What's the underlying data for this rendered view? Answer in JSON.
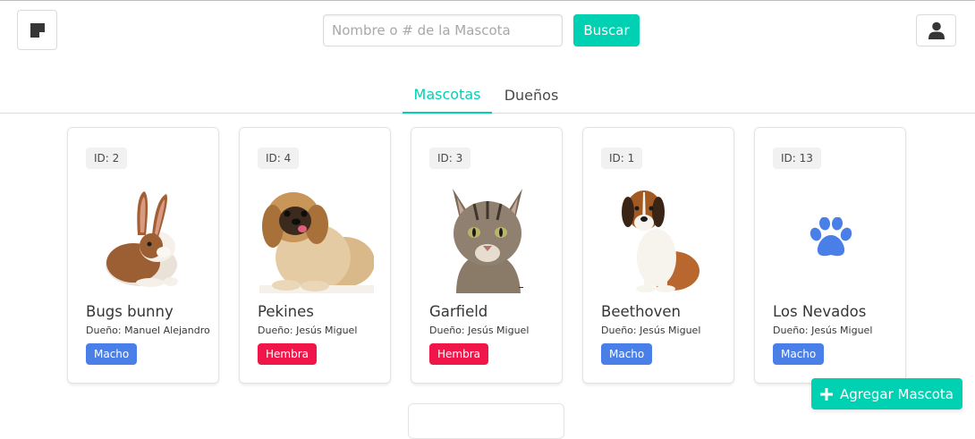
{
  "header": {
    "search_placeholder": "Nombre o # de la Mascota",
    "search_button": "Buscar",
    "menu_icon": "sticky-note-icon",
    "user_icon": "user-icon"
  },
  "tabs": [
    {
      "label": "Mascotas",
      "active": true
    },
    {
      "label": "Dueños",
      "active": false
    }
  ],
  "pets": [
    {
      "id_label": "ID: 2",
      "name": "Bugs bunny",
      "owner": "Dueño: Manuel Alejandro",
      "sex": "Macho",
      "image": "rabbit-photo"
    },
    {
      "id_label": "ID: 4",
      "name": "Pekines",
      "owner": "Dueño: Jesús Miguel",
      "sex": "Hembra",
      "image": "pekingese-dog-photo"
    },
    {
      "id_label": "ID: 3",
      "name": "Garfield",
      "owner": "Dueño: Jesús Miguel",
      "sex": "Hembra",
      "image": "tabby-cat-photo"
    },
    {
      "id_label": "ID: 1",
      "name": "Beethoven",
      "owner": "Dueño: Jesús Miguel",
      "sex": "Macho",
      "image": "saint-bernard-dog-photo"
    },
    {
      "id_label": "ID: 13",
      "name": "Los Nevados",
      "owner": "Dueño: Jesús Miguel",
      "sex": "Macho",
      "image": "paw-icon"
    }
  ],
  "add_button": "Agregar Mascota",
  "colors": {
    "primary": "#00d1b2",
    "male": "#4a7fe8",
    "female": "#f1164a",
    "paw": "#4a7fe8"
  }
}
